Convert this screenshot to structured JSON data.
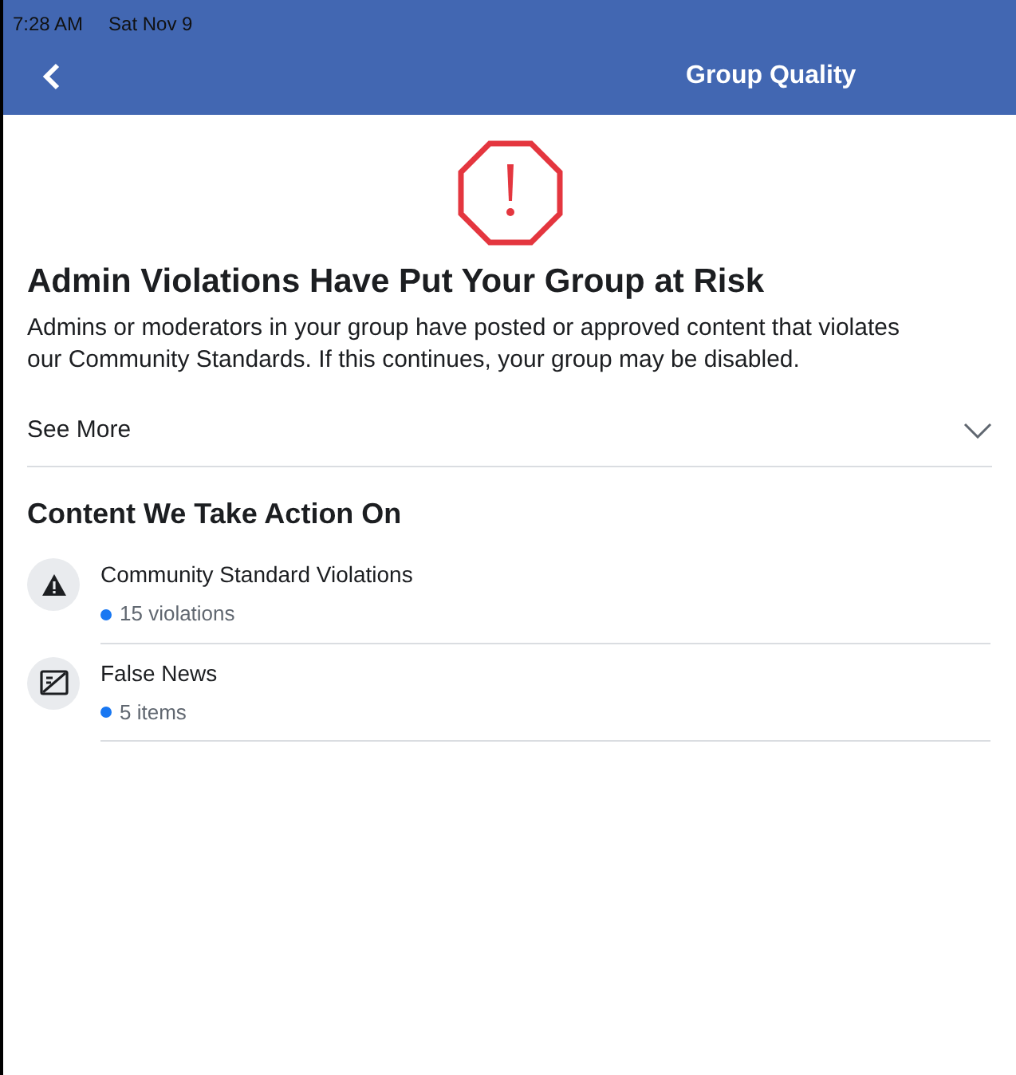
{
  "status_bar": {
    "time": "7:28 AM",
    "date": "Sat Nov 9"
  },
  "header": {
    "title": "Group Quality"
  },
  "alert": {
    "heading": "Admin Violations Have Put Your Group at Risk",
    "body": "Admins or moderators in your group have posted or approved content that violates our Community Standards. If this continues, your group may be disabled.",
    "see_more": "See More",
    "expanded": false
  },
  "section": {
    "title": "Content We Take Action On",
    "items": [
      {
        "kind": "warning",
        "title": "Community Standard Violations",
        "count": "15 violations"
      },
      {
        "kind": "news",
        "title": "False News",
        "count": "5 items"
      }
    ]
  }
}
